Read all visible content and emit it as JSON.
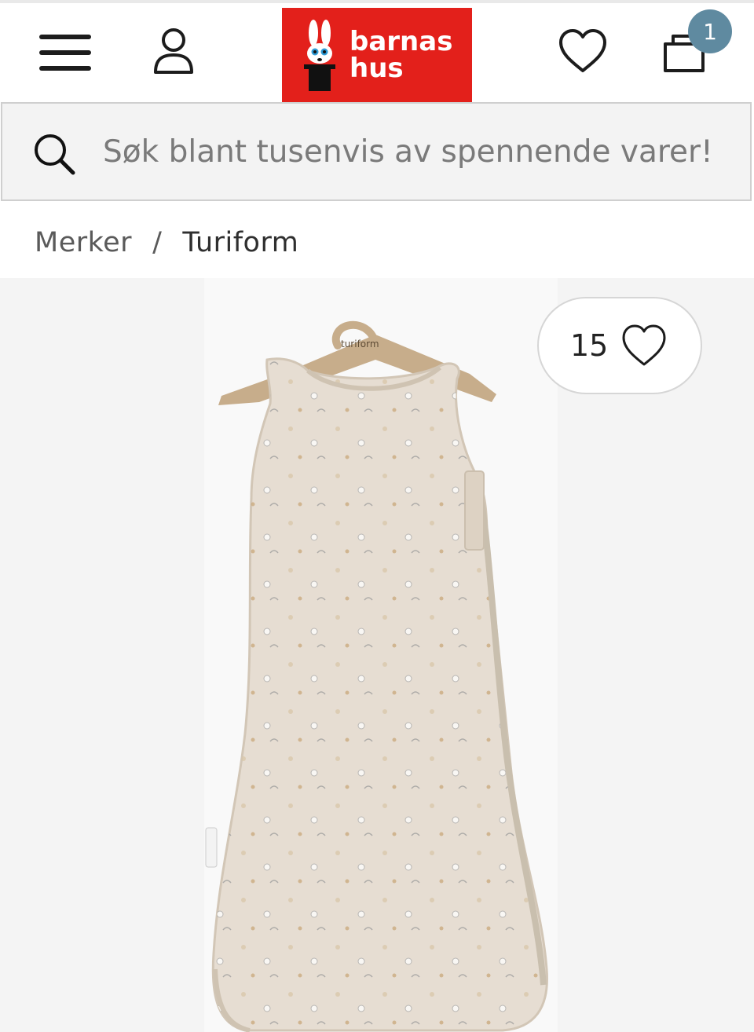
{
  "header": {
    "menu_icon": "hamburger-menu-icon",
    "account_icon": "user-icon",
    "logo": {
      "line1": "barnas",
      "line2": "hus",
      "background": "#e3201b",
      "mascot_icon": "rabbit-in-hat-icon"
    },
    "wishlist_icon": "heart-icon",
    "cart_icon": "shopping-bag-icon",
    "cart_count": "1",
    "badge_color": "#5f8aa0"
  },
  "search": {
    "icon": "search-icon",
    "placeholder": "Søk blant tusenvis av spennende varer!"
  },
  "breadcrumb": {
    "items": [
      "Merker",
      "Turiform"
    ],
    "separator": "/"
  },
  "product": {
    "image_icon": "sleeping-bag-product-image",
    "hanger_label": "turiform",
    "favorites_count": "15",
    "favorite_icon": "heart-outline-icon"
  }
}
